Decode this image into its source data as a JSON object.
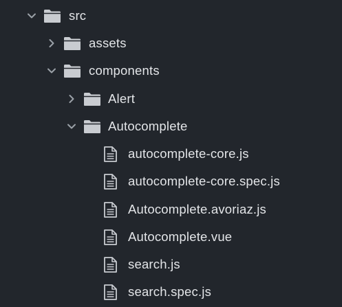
{
  "colors": {
    "background": "#22262c",
    "text": "#e3e5e8",
    "icon": "#c9ccd1",
    "chevron": "#9ba1a8"
  },
  "tree": {
    "nodes": [
      {
        "label": "src",
        "kind": "folder",
        "depth": 0,
        "expanded": true,
        "chevron": "chevron-down-icon",
        "icon": "folder-icon"
      },
      {
        "label": "assets",
        "kind": "folder",
        "depth": 1,
        "expanded": false,
        "chevron": "chevron-right-icon",
        "icon": "folder-icon"
      },
      {
        "label": "components",
        "kind": "folder",
        "depth": 1,
        "expanded": true,
        "chevron": "chevron-down-icon",
        "icon": "folder-icon"
      },
      {
        "label": "Alert",
        "kind": "folder",
        "depth": 2,
        "expanded": false,
        "chevron": "chevron-right-icon",
        "icon": "folder-icon"
      },
      {
        "label": "Autocomplete",
        "kind": "folder",
        "depth": 2,
        "expanded": true,
        "chevron": "chevron-down-icon",
        "icon": "folder-icon"
      },
      {
        "label": "autocomplete-core.js",
        "kind": "file",
        "depth": 3,
        "icon": "file-icon"
      },
      {
        "label": "autocomplete-core.spec.js",
        "kind": "file",
        "depth": 3,
        "icon": "file-icon"
      },
      {
        "label": "Autocomplete.avoriaz.js",
        "kind": "file",
        "depth": 3,
        "icon": "file-icon"
      },
      {
        "label": "Autocomplete.vue",
        "kind": "file",
        "depth": 3,
        "icon": "file-icon"
      },
      {
        "label": "search.js",
        "kind": "file",
        "depth": 3,
        "icon": "file-icon"
      },
      {
        "label": "search.spec.js",
        "kind": "file",
        "depth": 3,
        "icon": "file-icon"
      }
    ]
  }
}
